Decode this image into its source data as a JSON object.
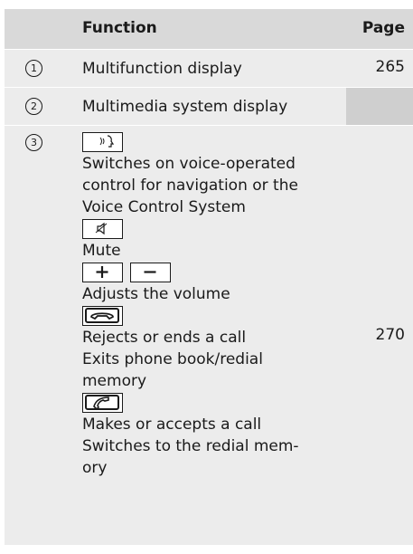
{
  "header": {
    "function": "Function",
    "page": "Page"
  },
  "rows": [
    {
      "num": "1",
      "function": "Multifunction display",
      "page": "265"
    },
    {
      "num": "2",
      "function": "Multimedia system display",
      "page": ""
    },
    {
      "num": "3",
      "page": "270",
      "voice_text": [
        "Switches on voice-operated",
        "control for navigation or the",
        "Voice Control System"
      ],
      "mute_text": "Mute",
      "volume_text": "Adjusts the volume",
      "reject_text": [
        "Rejects or ends a call",
        "Exits phone book/redial",
        "memory"
      ],
      "accept_text": [
        "Makes or accepts a call",
        "Switches to the redial mem-",
        "ory"
      ]
    }
  ],
  "icons": [
    "voice-control-icon",
    "mute-icon",
    "plus-icon",
    "minus-icon",
    "hang-up-icon",
    "phone-icon"
  ]
}
